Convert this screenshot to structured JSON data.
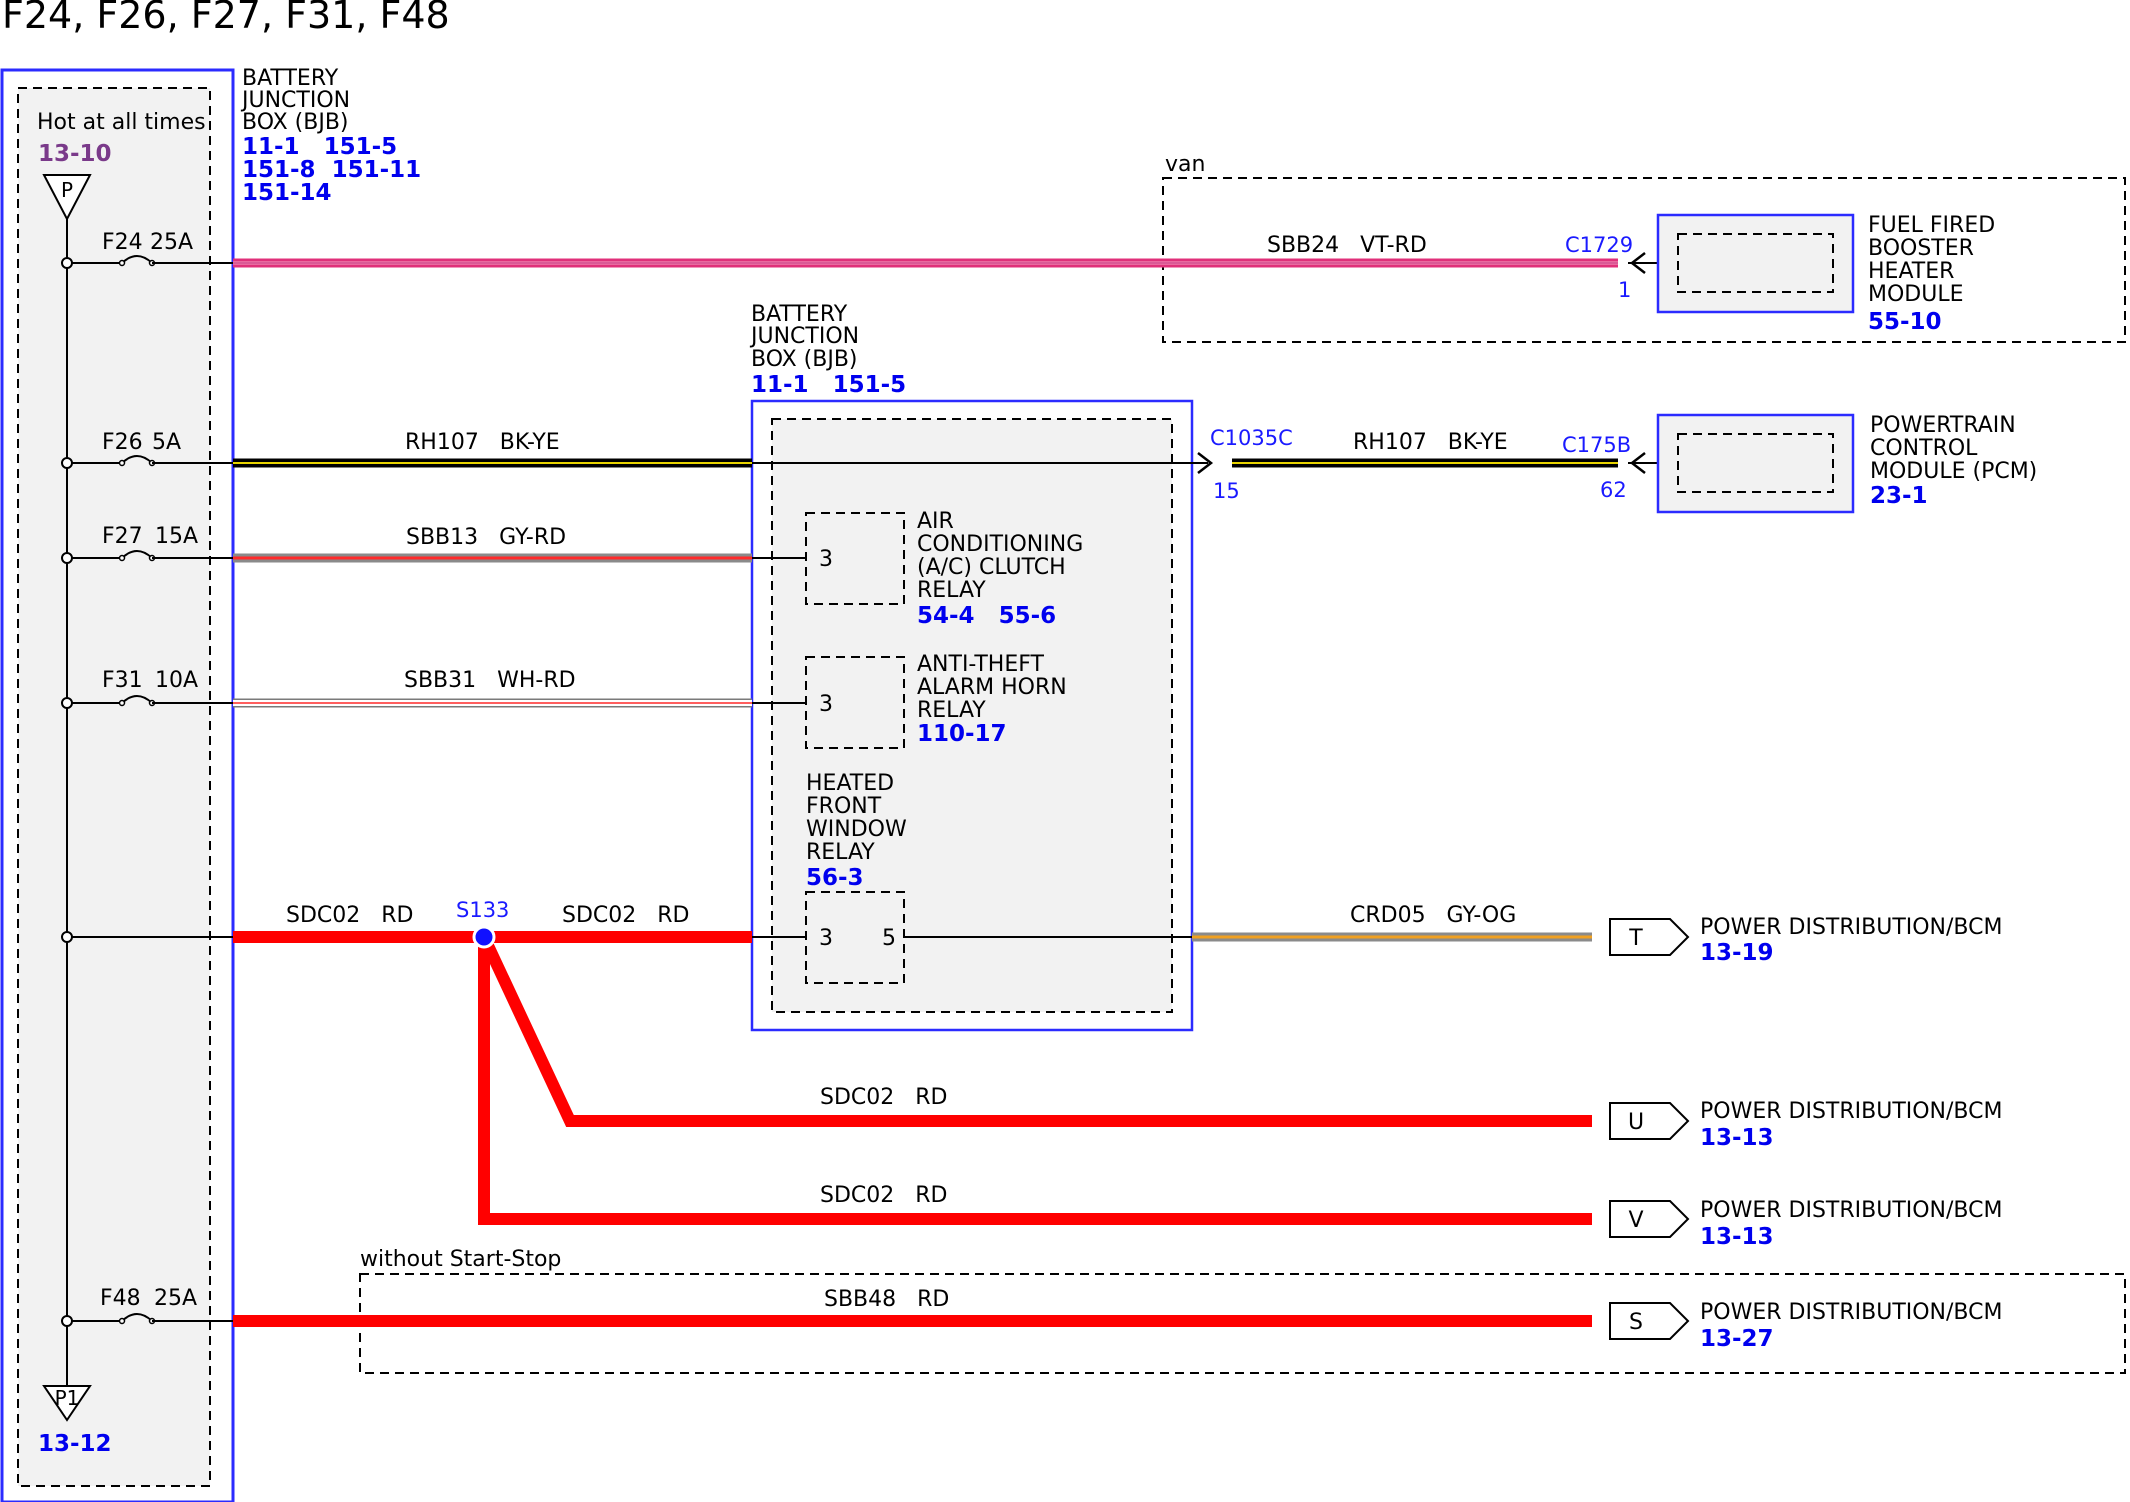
{
  "title": "F24, F26, F27, F31, F48",
  "colors": {
    "blue": "#0000ee",
    "module_border": "#2b2bff",
    "red": "#ff0000",
    "pink": "#e0307a",
    "black": "#000000",
    "gray_fill": "#f2f2f2",
    "purple": "#7a3a8a"
  },
  "bjb_left": {
    "name_lines": [
      "BATTERY",
      "JUNCTION",
      "BOX (BJB)"
    ],
    "refs": [
      "11-1   151-5",
      "151-8  151-11",
      "151-14"
    ],
    "hot_label": "Hot at all times",
    "hot_ref": "13-10",
    "top_connector": "P",
    "bottom_connector": "P1",
    "bottom_ref": "13-12"
  },
  "fuses": [
    {
      "id": "F24",
      "rating": "25A"
    },
    {
      "id": "F26",
      "rating": "5A"
    },
    {
      "id": "F27",
      "rating": "15A"
    },
    {
      "id": "F31",
      "rating": "10A"
    },
    {
      "id": "F48",
      "rating": "25A"
    }
  ],
  "bjb_center": {
    "name_lines": [
      "BATTERY",
      "JUNCTION",
      "BOX (BJB)"
    ],
    "refs": "11-1   151-5"
  },
  "relays": [
    {
      "name_lines": [
        "AIR",
        "CONDITIONING",
        "(A/C) CLUTCH",
        "RELAY"
      ],
      "refs": "54-4   55-6",
      "pin": "3"
    },
    {
      "name_lines": [
        "ANTI-THEFT",
        "ALARM HORN",
        "RELAY"
      ],
      "refs": "110-17",
      "pin": "3"
    },
    {
      "name_lines": [
        "HEATED",
        "FRONT",
        "WINDOW",
        "RELAY"
      ],
      "refs": "56-3",
      "pin_in": "3",
      "pin_out": "5"
    }
  ],
  "wires": {
    "f24": "SBB24   VT-RD",
    "f26_left": "RH107   BK-YE",
    "f26_right": "RH107   BK-YE",
    "f27": "SBB13   GY-RD",
    "f31": "SBB31   WH-RD",
    "sdc_left": "SDC02   RD",
    "sdc_right": "SDC02   RD",
    "crd": "CRD05   GY-OG",
    "sdc_u": "SDC02   RD",
    "sdc_v": "SDC02   RD",
    "sbb48": "SBB48   RD"
  },
  "splice": "S133",
  "connectors": {
    "c1729": "C1729",
    "c1729_pin": "1",
    "c1035c": "C1035C",
    "c1035c_pin": "15",
    "c175b": "C175B",
    "c175b_pin": "62"
  },
  "modules": [
    {
      "name_lines": [
        "FUEL FIRED",
        "BOOSTER",
        "HEATER",
        "MODULE"
      ],
      "ref": "55-10"
    },
    {
      "name_lines": [
        "POWERTRAIN",
        "CONTROL",
        "MODULE (PCM)"
      ],
      "ref": "23-1"
    }
  ],
  "options": {
    "van": "van",
    "without_start_stop": "without Start-Stop"
  },
  "destinations": [
    {
      "letter": "T",
      "label": "POWER DISTRIBUTION/BCM",
      "ref": "13-19"
    },
    {
      "letter": "U",
      "label": "POWER DISTRIBUTION/BCM",
      "ref": "13-13"
    },
    {
      "letter": "V",
      "label": "POWER DISTRIBUTION/BCM",
      "ref": "13-13"
    },
    {
      "letter": "S",
      "label": "POWER DISTRIBUTION/BCM",
      "ref": "13-27"
    }
  ]
}
